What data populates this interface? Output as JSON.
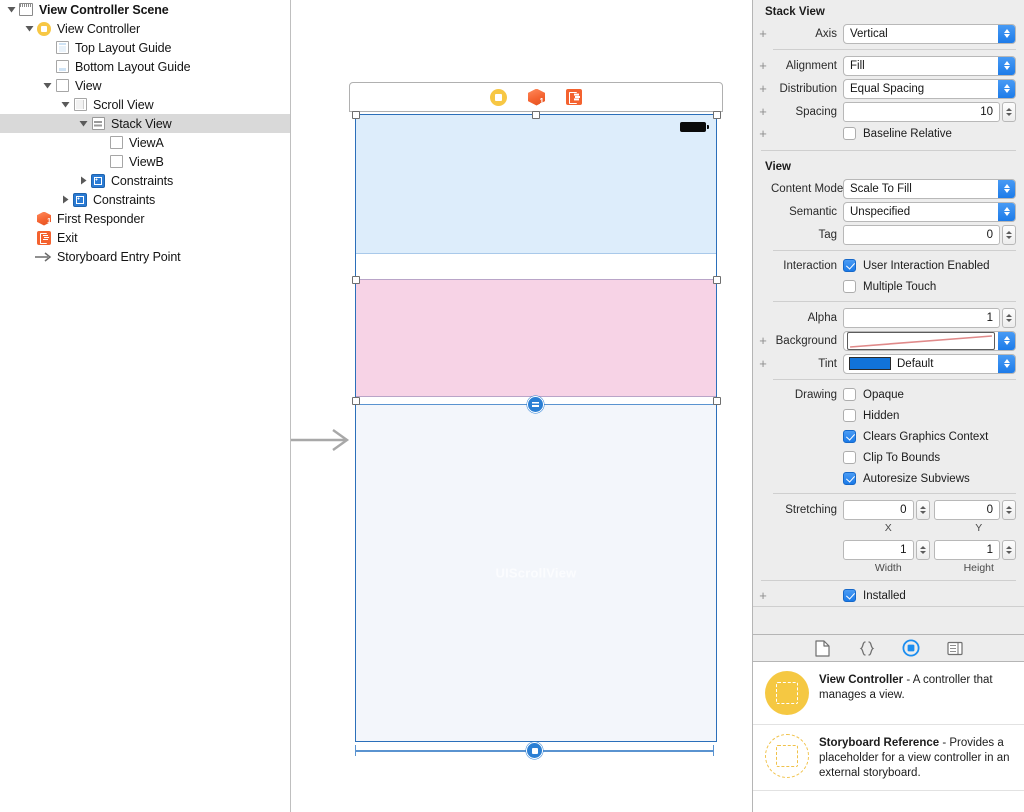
{
  "outline": {
    "items": [
      {
        "label": "View Controller Scene",
        "icon": "scene-icon",
        "indent": 0,
        "disclosure": "open",
        "bold": true,
        "selected": false
      },
      {
        "label": "View Controller",
        "icon": "view-controller-icon",
        "indent": 1,
        "disclosure": "open",
        "bold": false,
        "selected": false
      },
      {
        "label": "Top Layout Guide",
        "icon": "top-layout-guide-icon",
        "indent": 2,
        "disclosure": "none",
        "bold": false,
        "selected": false
      },
      {
        "label": "Bottom Layout Guide",
        "icon": "bottom-layout-guide-icon",
        "indent": 2,
        "disclosure": "none",
        "bold": false,
        "selected": false
      },
      {
        "label": "View",
        "icon": "view-icon",
        "indent": 2,
        "disclosure": "open",
        "bold": false,
        "selected": false
      },
      {
        "label": "Scroll View",
        "icon": "scroll-view-icon",
        "indent": 3,
        "disclosure": "open",
        "bold": false,
        "selected": false
      },
      {
        "label": "Stack View",
        "icon": "stack-view-icon",
        "indent": 4,
        "disclosure": "open",
        "bold": false,
        "selected": true
      },
      {
        "label": "ViewA",
        "icon": "view-icon",
        "indent": 5,
        "disclosure": "none",
        "bold": false,
        "selected": false
      },
      {
        "label": "ViewB",
        "icon": "view-icon",
        "indent": 5,
        "disclosure": "none",
        "bold": false,
        "selected": false
      },
      {
        "label": "Constraints",
        "icon": "constraints-icon",
        "indent": 4,
        "disclosure": "closed",
        "bold": false,
        "selected": false
      },
      {
        "label": "Constraints",
        "icon": "constraints-icon",
        "indent": 3,
        "disclosure": "closed",
        "bold": false,
        "selected": false
      },
      {
        "label": "First Responder",
        "icon": "first-responder-icon",
        "indent": 1,
        "disclosure": "none",
        "bold": false,
        "selected": false
      },
      {
        "label": "Exit",
        "icon": "exit-icon",
        "indent": 1,
        "disclosure": "none",
        "bold": false,
        "selected": false
      },
      {
        "label": "Storyboard Entry Point",
        "icon": "entry-point-arrow-icon",
        "indent": 1,
        "disclosure": "none",
        "bold": false,
        "selected": false
      }
    ]
  },
  "canvas": {
    "dock": {
      "view_controller_icon": "view-controller-icon",
      "first_responder_icon": "first-responder-icon",
      "first_responder_badge": "1",
      "exit_icon": "exit-icon"
    },
    "scroll_view_watermark": "UIScrollView",
    "views": {
      "view_a_color": "#ddedfb",
      "view_b_color": "#f7d3e6",
      "scroll_view_color": "#f3f6fb",
      "selection_color": "#2b6fba"
    }
  },
  "inspector": {
    "stack_view": {
      "title": "Stack View",
      "axis_label": "Axis",
      "axis_value": "Vertical",
      "alignment_label": "Alignment",
      "alignment_value": "Fill",
      "distribution_label": "Distribution",
      "distribution_value": "Equal Spacing",
      "spacing_label": "Spacing",
      "spacing_value": "10",
      "baseline_relative_label": "Baseline Relative",
      "baseline_relative_checked": false
    },
    "view": {
      "title": "View",
      "content_mode_label": "Content Mode",
      "content_mode_value": "Scale To Fill",
      "semantic_label": "Semantic",
      "semantic_value": "Unspecified",
      "tag_label": "Tag",
      "tag_value": "0",
      "interaction_label": "Interaction",
      "user_interaction_label": "User Interaction Enabled",
      "user_interaction_checked": true,
      "multiple_touch_label": "Multiple Touch",
      "multiple_touch_checked": false,
      "alpha_label": "Alpha",
      "alpha_value": "1",
      "background_label": "Background",
      "background_swatch_color": "#ffffff",
      "tint_label": "Tint",
      "tint_value": "Default",
      "tint_swatch_color": "#1173d9",
      "drawing_label": "Drawing",
      "opaque_label": "Opaque",
      "opaque_checked": false,
      "hidden_label": "Hidden",
      "hidden_checked": false,
      "clears_graphics_label": "Clears Graphics Context",
      "clears_graphics_checked": true,
      "clip_to_bounds_label": "Clip To Bounds",
      "clip_to_bounds_checked": false,
      "autoresize_subviews_label": "Autoresize Subviews",
      "autoresize_subviews_checked": true,
      "stretching_label": "Stretching",
      "stretching_x_value": "0",
      "stretching_y_value": "0",
      "stretching_x_sublabel": "X",
      "stretching_y_sublabel": "Y",
      "stretching_width_value": "1",
      "stretching_height_value": "1",
      "stretching_width_sublabel": "Width",
      "stretching_height_sublabel": "Height",
      "installed_label": "Installed",
      "installed_checked": true
    },
    "library": {
      "tabs": [
        {
          "name": "file-template-library-icon",
          "selected": false
        },
        {
          "name": "code-snippet-library-icon",
          "selected": false
        },
        {
          "name": "object-library-icon",
          "selected": true
        },
        {
          "name": "media-library-icon",
          "selected": false
        }
      ],
      "items": [
        {
          "icon": "view-controller-object-icon",
          "title": "View Controller",
          "description": " - A controller that manages a view."
        },
        {
          "icon": "storyboard-reference-object-icon",
          "title": "Storyboard Reference",
          "description": " - Provides a placeholder for a view controller in an external storyboard."
        }
      ]
    }
  }
}
